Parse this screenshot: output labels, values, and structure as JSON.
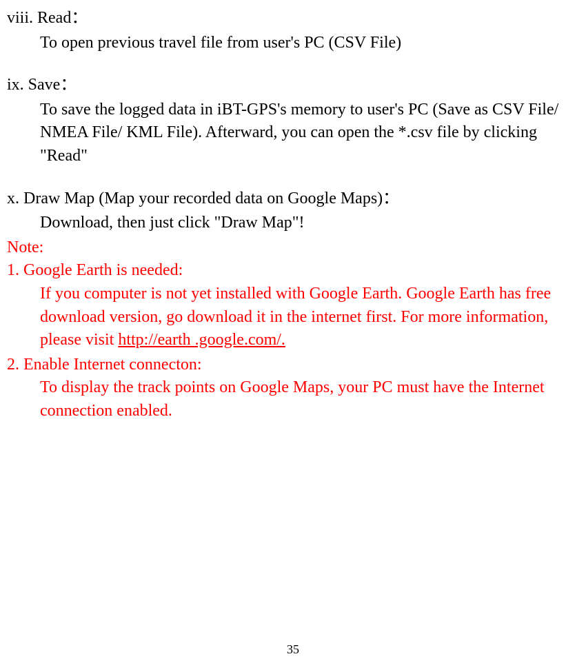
{
  "sections": {
    "viii": {
      "heading": "viii. Read：",
      "body": "To open previous travel file from user's PC (CSV File)"
    },
    "ix": {
      "heading": "ix. Save：",
      "body": "To save the logged data in iBT-GPS's memory to user's PC (Save as CSV File/ NMEA File/ KML File). Afterward, you can open the *.csv file by clicking \"Read\""
    },
    "x": {
      "heading": "x. Draw Map (Map your recorded data on Google Maps)：",
      "body": "Download, then just click \"Draw Map\"!"
    }
  },
  "note": {
    "label": "Note:",
    "items": {
      "one": {
        "heading": "1. Google Earth is needed:",
        "body_pre": "If you computer is not yet installed with Google Earth. Google Earth has free download version, go download it in the internet first. For more information, please visit ",
        "link": "http://earth .google.com/."
      },
      "two": {
        "heading": "2. Enable Internet connecton:",
        "body": "To display the track points on Google Maps, your PC must have the Internet connection enabled."
      }
    }
  },
  "page_number": "35"
}
